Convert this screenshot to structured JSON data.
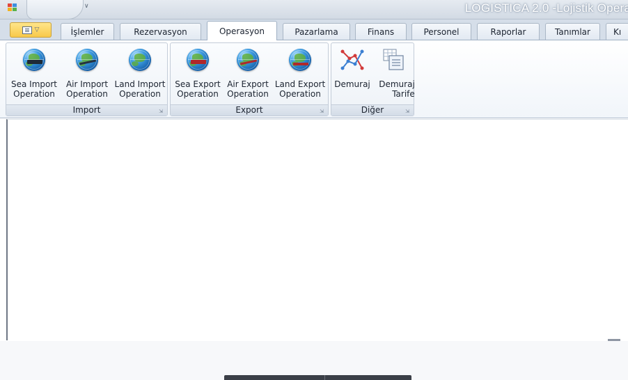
{
  "window": {
    "title": "LOGISTICA 2.0 -Lojistik Opera"
  },
  "tabs": [
    {
      "label": "İşlemler",
      "active": false
    },
    {
      "label": "Rezervasyon",
      "active": false
    },
    {
      "label": "Operasyon",
      "active": true
    },
    {
      "label": "Pazarlama",
      "active": false
    },
    {
      "label": "Finans",
      "active": false
    },
    {
      "label": "Personel",
      "active": false
    },
    {
      "label": "Raporlar",
      "active": false
    },
    {
      "label": "Tanımlar",
      "active": false
    },
    {
      "label": "Kı",
      "active": false
    }
  ],
  "ribbon": {
    "groups": [
      {
        "label": "Import",
        "buttons": [
          {
            "label": "Sea Import\nOperation",
            "icon": "ship-globe-icon"
          },
          {
            "label": "Air Import\nOperation",
            "icon": "plane-globe-icon"
          },
          {
            "label": "Land Import\nOperation",
            "icon": "globe-icon"
          }
        ]
      },
      {
        "label": "Export",
        "buttons": [
          {
            "label": "Sea Export\nOperation",
            "icon": "ship-globe-icon"
          },
          {
            "label": "Air Export\nOperation",
            "icon": "plane-globe-icon"
          },
          {
            "label": "Land Export\nOperation",
            "icon": "truck-globe-icon"
          }
        ]
      },
      {
        "label": "Diğer",
        "buttons": [
          {
            "label": "Demuraj",
            "icon": "line-chart-icon"
          },
          {
            "label": "Demuraj\nTarife",
            "icon": "table-icon"
          }
        ]
      }
    ]
  },
  "colors": {
    "accent_menu": "#f8c94a",
    "tab_border": "#a9b6c5",
    "ribbon_bg": "#f1f5fa",
    "title_glow": "#a8b4c4"
  }
}
